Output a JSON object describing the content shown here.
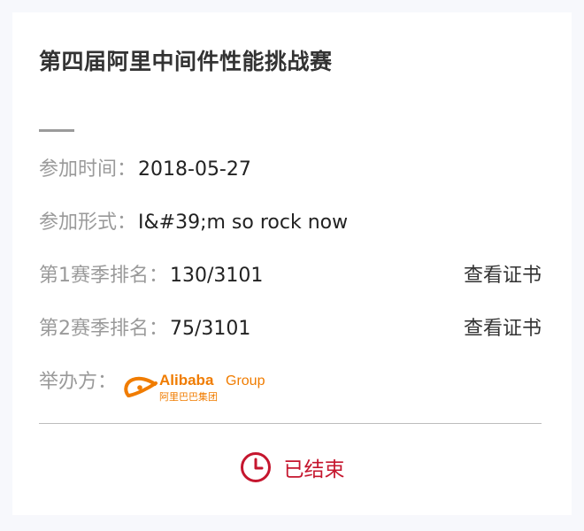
{
  "title": "第四届阿里中间件性能挑战赛",
  "details": {
    "time_label": "参加时间：",
    "time_value": "2018-05-27",
    "form_label": "参加形式：",
    "form_value": "I&#39;m so rock now",
    "season1_label": "第1赛季排名：",
    "season1_value": "130/3101",
    "season2_label": "第2赛季排名：",
    "season2_value": "75/3101",
    "organizer_label": "举办方："
  },
  "actions": {
    "view_certificate_1": "查看证书",
    "view_certificate_2": "查看证书"
  },
  "organizer_logo": {
    "name": "alibaba-group-logo",
    "text_en_1": "Alibaba",
    "text_en_2": "Group",
    "text_cn": "阿里巴巴集团",
    "color": "#f07c00"
  },
  "status": {
    "text": "已结束",
    "icon": "clock-icon",
    "color": "#c5162e"
  },
  "colors": {
    "background": "#f7f8fc",
    "card": "#ffffff",
    "label": "#9a9a9a",
    "value": "#222222"
  }
}
